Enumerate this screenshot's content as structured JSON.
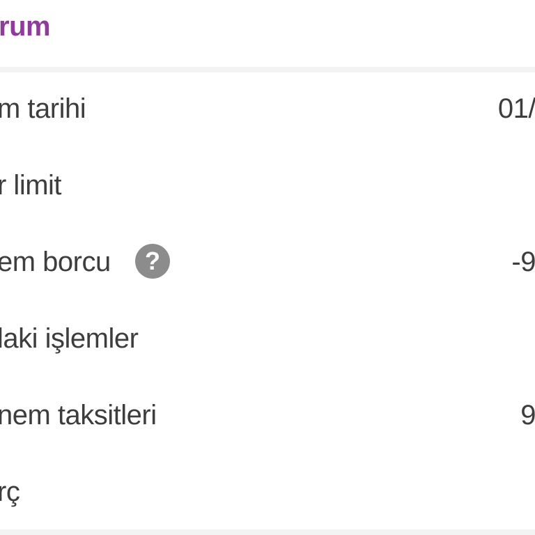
{
  "header": {
    "title": "rum"
  },
  "rows": [
    {
      "label": "m tarihi",
      "value": "01/"
    },
    {
      "label": "r limit",
      "value": ""
    },
    {
      "label": "em borcu",
      "value": "-9",
      "help_icon": "question-mark-icon"
    },
    {
      "label": "laki işlemler",
      "value": ""
    },
    {
      "label": "nem taksitleri",
      "value": "9"
    },
    {
      "label": "rç",
      "value": ""
    }
  ],
  "colors": {
    "accent": "#8e3b9b",
    "text": "#3d3d3d",
    "icon": "#8c8c8c",
    "background": "#f3f3f3"
  }
}
